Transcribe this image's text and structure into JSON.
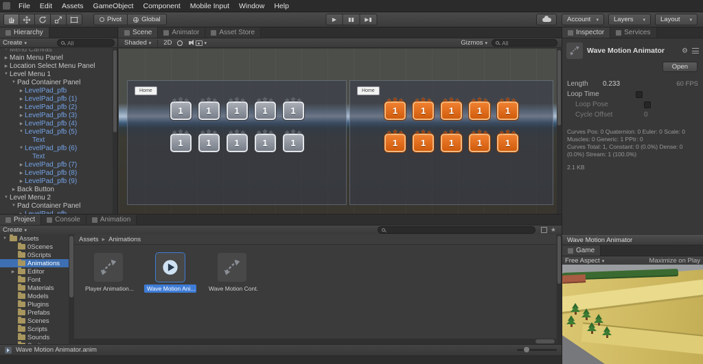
{
  "icons": {
    "star": "★",
    "dropdown": "▾",
    "arrow_right": "▶",
    "arrow_down": "▼",
    "play": "▶",
    "pause": "▮▮",
    "step": "▶▮",
    "gear": "⚙",
    "breadcrumb_sep": "▶"
  },
  "menu_bar": {
    "items": [
      "File",
      "Edit",
      "Assets",
      "GameObject",
      "Component",
      "Mobile Input",
      "Window",
      "Help"
    ]
  },
  "toolbar": {
    "pivot_label": "Pivot",
    "global_label": "Global",
    "dropdowns": [
      "Account",
      "Layers",
      "Layout"
    ]
  },
  "hierarchy": {
    "tab": "Hierarchy",
    "create_label": "Create",
    "search_value": "All",
    "items": [
      {
        "label": "Menu Canvas",
        "indent": 0,
        "arrow": "down",
        "type": "normal",
        "cut": true
      },
      {
        "label": "Main Menu Panel",
        "indent": 0,
        "arrow": "right",
        "type": "normal"
      },
      {
        "label": "Location Select Menu Panel",
        "indent": 0,
        "arrow": "right",
        "type": "normal"
      },
      {
        "label": "Level Menu 1",
        "indent": 0,
        "arrow": "down",
        "type": "normal"
      },
      {
        "label": "Pad Container Panel",
        "indent": 1,
        "arrow": "down",
        "type": "normal"
      },
      {
        "label": "LevelPad_pfb",
        "indent": 2,
        "arrow": "right",
        "type": "prefab"
      },
      {
        "label": "LevelPad_pfb (1)",
        "indent": 2,
        "arrow": "right",
        "type": "prefab"
      },
      {
        "label": "LevelPad_pfb (2)",
        "indent": 2,
        "arrow": "right",
        "type": "prefab"
      },
      {
        "label": "LevelPad_pfb (3)",
        "indent": 2,
        "arrow": "right",
        "type": "prefab"
      },
      {
        "label": "LevelPad_pfb (4)",
        "indent": 2,
        "arrow": "right",
        "type": "prefab"
      },
      {
        "label": "LevelPad_pfb (5)",
        "indent": 2,
        "arrow": "down",
        "type": "prefab"
      },
      {
        "label": "Text",
        "indent": 3,
        "arrow": "",
        "type": "prefab"
      },
      {
        "label": "LevelPad_pfb (6)",
        "indent": 2,
        "arrow": "down",
        "type": "prefab"
      },
      {
        "label": "Text",
        "indent": 3,
        "arrow": "",
        "type": "prefab"
      },
      {
        "label": "LevelPad_pfb (7)",
        "indent": 2,
        "arrow": "right",
        "type": "prefab"
      },
      {
        "label": "LevelPad_pfb (8)",
        "indent": 2,
        "arrow": "right",
        "type": "prefab"
      },
      {
        "label": "LevelPad_pfb (9)",
        "indent": 2,
        "arrow": "right",
        "type": "prefab"
      },
      {
        "label": "Back Button",
        "indent": 1,
        "arrow": "right",
        "type": "normal"
      },
      {
        "label": "Level Menu 2",
        "indent": 0,
        "arrow": "down",
        "type": "normal"
      },
      {
        "label": "Pad Container Panel",
        "indent": 1,
        "arrow": "down",
        "type": "normal"
      },
      {
        "label": "LevelPad_pfb",
        "indent": 2,
        "arrow": "right",
        "type": "prefab"
      }
    ]
  },
  "scene": {
    "tabs": [
      "Scene",
      "Animator",
      "Asset Store"
    ],
    "shaded_label": "Shaded",
    "mode_2d": "2D",
    "gizmos_label": "Gizmos",
    "search_value": "All",
    "panels": [
      {
        "home_label": "Home",
        "pad_value": "1",
        "color": "grey",
        "rows": 2,
        "cols": 5
      },
      {
        "home_label": "Home",
        "pad_value": "1",
        "color": "orange",
        "rows": 2,
        "cols": 5
      }
    ]
  },
  "project": {
    "tabs": [
      "Project",
      "Console",
      "Animation"
    ],
    "create_label": "Create",
    "folders": [
      {
        "label": "Assets",
        "indent": 0,
        "arrow": "down"
      },
      {
        "label": "0Scenes",
        "indent": 1,
        "arrow": ""
      },
      {
        "label": "0Scripts",
        "indent": 1,
        "arrow": ""
      },
      {
        "label": "Animations",
        "indent": 1,
        "arrow": "",
        "selected": true
      },
      {
        "label": "Editor",
        "indent": 1,
        "arrow": "right"
      },
      {
        "label": "Font",
        "indent": 1,
        "arrow": ""
      },
      {
        "label": "Materials",
        "indent": 1,
        "arrow": ""
      },
      {
        "label": "Models",
        "indent": 1,
        "arrow": ""
      },
      {
        "label": "Plugins",
        "indent": 1,
        "arrow": ""
      },
      {
        "label": "Prefabs",
        "indent": 1,
        "arrow": ""
      },
      {
        "label": "Scenes",
        "indent": 1,
        "arrow": ""
      },
      {
        "label": "Scripts",
        "indent": 1,
        "arrow": ""
      },
      {
        "label": "Sounds",
        "indent": 1,
        "arrow": ""
      },
      {
        "label": "Sprites",
        "indent": 1,
        "arrow": ""
      }
    ],
    "breadcrumb": [
      "Assets",
      "Animations"
    ],
    "items": [
      {
        "label": "Player Animation...",
        "icon": "clip",
        "selected": false
      },
      {
        "label": "Wave Motion Ani...",
        "icon": "play",
        "selected": true
      },
      {
        "label": "Wave Motion Cont...",
        "icon": "clip",
        "selected": false
      }
    ],
    "status_file": "Wave Motion Animator.anim"
  },
  "inspector": {
    "tabs": [
      "Inspector",
      "Services"
    ],
    "title": "Wave Motion Animator",
    "open_button": "Open",
    "fields": [
      {
        "label": "Length",
        "value": "0.233",
        "extra": "60 FPS",
        "narrow": true,
        "checkbox": false,
        "disabled": false,
        "indent": false
      },
      {
        "label": "Loop Time",
        "value": "",
        "extra": "",
        "narrow": false,
        "checkbox": true,
        "disabled": false,
        "indent": false
      },
      {
        "label": "Loop Pose",
        "value": "",
        "extra": "",
        "narrow": false,
        "checkbox": true,
        "disabled": true,
        "indent": true
      },
      {
        "label": "Cycle Offset",
        "value": "0",
        "extra": "",
        "narrow": false,
        "checkbox": false,
        "disabled": true,
        "indent": true
      }
    ],
    "stats": [
      "Curves Pos: 0 Quaternion: 0 Euler: 0 Scale: 0",
      "Muscles: 0 Generic: 1 PPtr: 0",
      "Curves Total: 1, Constant: 0 (0.0%) Dense: 0",
      "(0.0%) Stream: 1 (100.0%)",
      "2.1 KB"
    ]
  },
  "preview": {
    "title": "Wave Motion Animator"
  },
  "game": {
    "tab": "Game",
    "aspect": "Free Aspect",
    "maximize": "Maximize on Play"
  }
}
